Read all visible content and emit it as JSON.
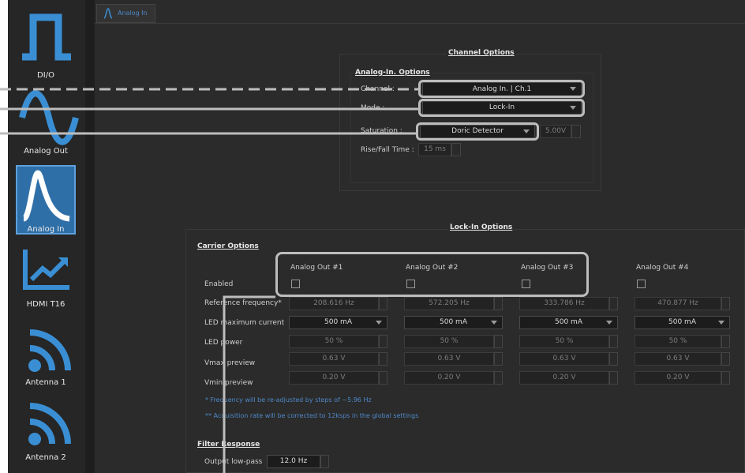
{
  "sidebar": {
    "items": [
      {
        "label": "DI/O",
        "icon": "square-wave-icon"
      },
      {
        "label": "Analog Out",
        "icon": "sine-wave-icon"
      },
      {
        "label": "Analog In",
        "icon": "pulse-decay-icon"
      },
      {
        "label": "HDMI T16",
        "icon": "chart-trend-icon"
      },
      {
        "label": "Antenna 1",
        "icon": "wifi-antenna-icon"
      },
      {
        "label": "Antenna 2",
        "icon": "wifi-antenna-icon"
      }
    ],
    "active_index": 2,
    "accent": "#3a8fd4"
  },
  "tab": {
    "label": "Analog In"
  },
  "channel_options": {
    "title": "Channel Options",
    "subtitle": "Analog-In. Options",
    "channel_label": "Channel :",
    "channel_value": "Analog In. | Ch.1",
    "mode_label": "Mode :",
    "mode_value": "Lock-In",
    "saturation_label": "Saturation :",
    "saturation_value": "Doric Detector",
    "saturation_voltage": "5.00V",
    "rise_label": "Rise/Fall Time :",
    "rise_value": "15 ms"
  },
  "lockin": {
    "title": "Lock-In Options",
    "carrier_title": "Carrier Options",
    "row_labels": [
      "Enabled",
      "Reference frequency*",
      "LED maximum current",
      "LED power",
      "Vmax preview",
      "Vmin preview"
    ],
    "columns": [
      {
        "name": "Analog Out #1",
        "freq": "208.616 Hz",
        "current": "500 mA",
        "power": "50 %",
        "vmax": "0.63 V",
        "vmin": "0.20 V"
      },
      {
        "name": "Analog Out #2",
        "freq": "572.205 Hz",
        "current": "500 mA",
        "power": "50 %",
        "vmax": "0.63 V",
        "vmin": "0.20 V"
      },
      {
        "name": "Analog Out #3",
        "freq": "333.786 Hz",
        "current": "500 mA",
        "power": "50 %",
        "vmax": "0.63 V",
        "vmin": "0.20 V"
      },
      {
        "name": "Analog Out #4",
        "freq": "470.877 Hz",
        "current": "500 mA",
        "power": "50 %",
        "vmax": "0.63 V",
        "vmin": "0.20 V"
      }
    ],
    "note1": "* Frequency will be re-adjusted by steps of ~5.96 Hz",
    "note2": "** Acquisition rate will be corrected to 12ksps in the global settings",
    "filter_title": "Filter Response",
    "lowpass_label": "Output low-pass",
    "lowpass_value": "12.0 Hz"
  }
}
